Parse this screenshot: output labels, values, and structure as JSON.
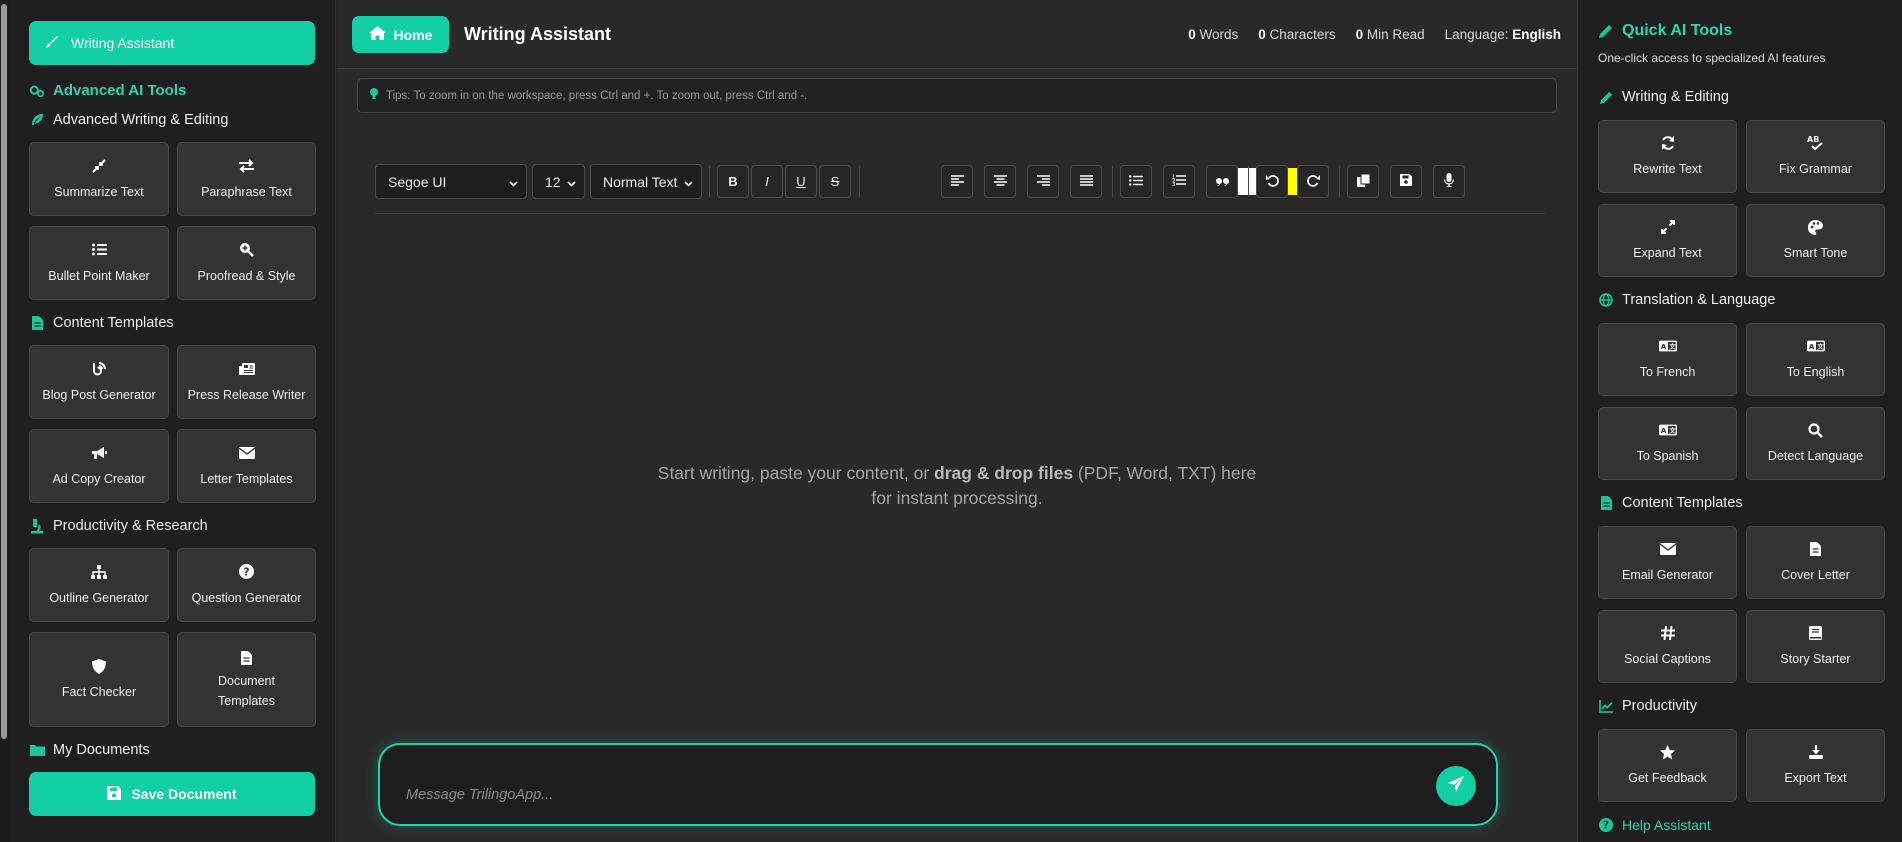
{
  "left": {
    "writing_assistant": "Writing Assistant",
    "advanced_title": "Advanced AI Tools",
    "sections": {
      "writing": "Advanced Writing & Editing",
      "templates": "Content Templates",
      "productivity": "Productivity & Research",
      "documents": "My Documents"
    },
    "cards": {
      "summarize": "Summarize Text",
      "paraphrase": "Paraphrase Text",
      "bullet": "Bullet Point Maker",
      "proofread": "Proofread & Style",
      "blog": "Blog Post Generator",
      "press": "Press Release Writer",
      "adcopy": "Ad Copy Creator",
      "letter": "Letter Templates",
      "outline": "Outline Generator",
      "question": "Question Generator",
      "fact": "Fact Checker",
      "doc_templates": "Document Templates"
    },
    "save": "Save Document"
  },
  "main": {
    "home": "Home",
    "title": "Writing Assistant",
    "stats": {
      "words_count": "0",
      "words_label": "Words",
      "chars_count": "0",
      "chars_label": "Characters",
      "read_count": "0",
      "read_label": "Min Read",
      "language_label": "Language:",
      "language_value": "English"
    },
    "tips": "Tips: To zoom in on the workspace, press Ctrl and +. To zoom out, press Ctrl and -.",
    "toolbar": {
      "font": "Segoe UI",
      "size": "12",
      "style": "Normal Text",
      "bold": "B",
      "italic": "I",
      "underline": "U",
      "strike": "S",
      "text_color": "#ffffff",
      "highlight_color": "#ffff00"
    },
    "placeholder_a": "Start writing, paste your content, or ",
    "placeholder_b": "drag & drop files",
    "placeholder_c": " (PDF, Word, TXT) here",
    "placeholder_d": "for instant processing.",
    "message_placeholder": "Message TrilingoApp..."
  },
  "right": {
    "title": "Quick AI Tools",
    "subtitle": "One-click access to specialized AI features",
    "sections": {
      "writing": "Writing & Editing",
      "translation": "Translation & Language",
      "templates": "Content Templates",
      "productivity": "Productivity",
      "help": "Help Assistant"
    },
    "cards": {
      "rewrite": "Rewrite Text",
      "grammar": "Fix Grammar",
      "expand": "Expand Text",
      "tone": "Smart Tone",
      "french": "To French",
      "english": "To English",
      "spanish": "To Spanish",
      "detect": "Detect Language",
      "email": "Email Generator",
      "cover": "Cover Letter",
      "social": "Social Captions",
      "story": "Story Starter",
      "feedback": "Get Feedback",
      "export": "Export Text"
    }
  },
  "colors": {
    "accent": "#12cfa6",
    "background": "#292929",
    "sidebar": "#1f1f1f"
  }
}
